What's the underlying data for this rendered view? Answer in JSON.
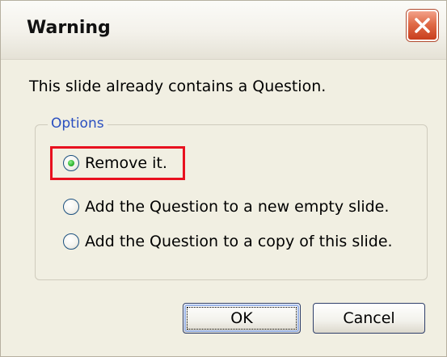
{
  "dialog": {
    "title": "Warning",
    "message": "This slide already contains a Question.",
    "options_legend": "Options",
    "options": [
      {
        "label": "Remove it.",
        "selected": true
      },
      {
        "label": "Add the Question to a new empty slide.",
        "selected": false
      },
      {
        "label": "Add the Question to a copy of this slide.",
        "selected": false
      }
    ],
    "ok_label": "OK",
    "cancel_label": "Cancel"
  },
  "colors": {
    "title_bar": "#f3f1ea",
    "close_button": "#e06b48",
    "legend_text": "#2a4fc0",
    "highlight": "#e8111f"
  }
}
